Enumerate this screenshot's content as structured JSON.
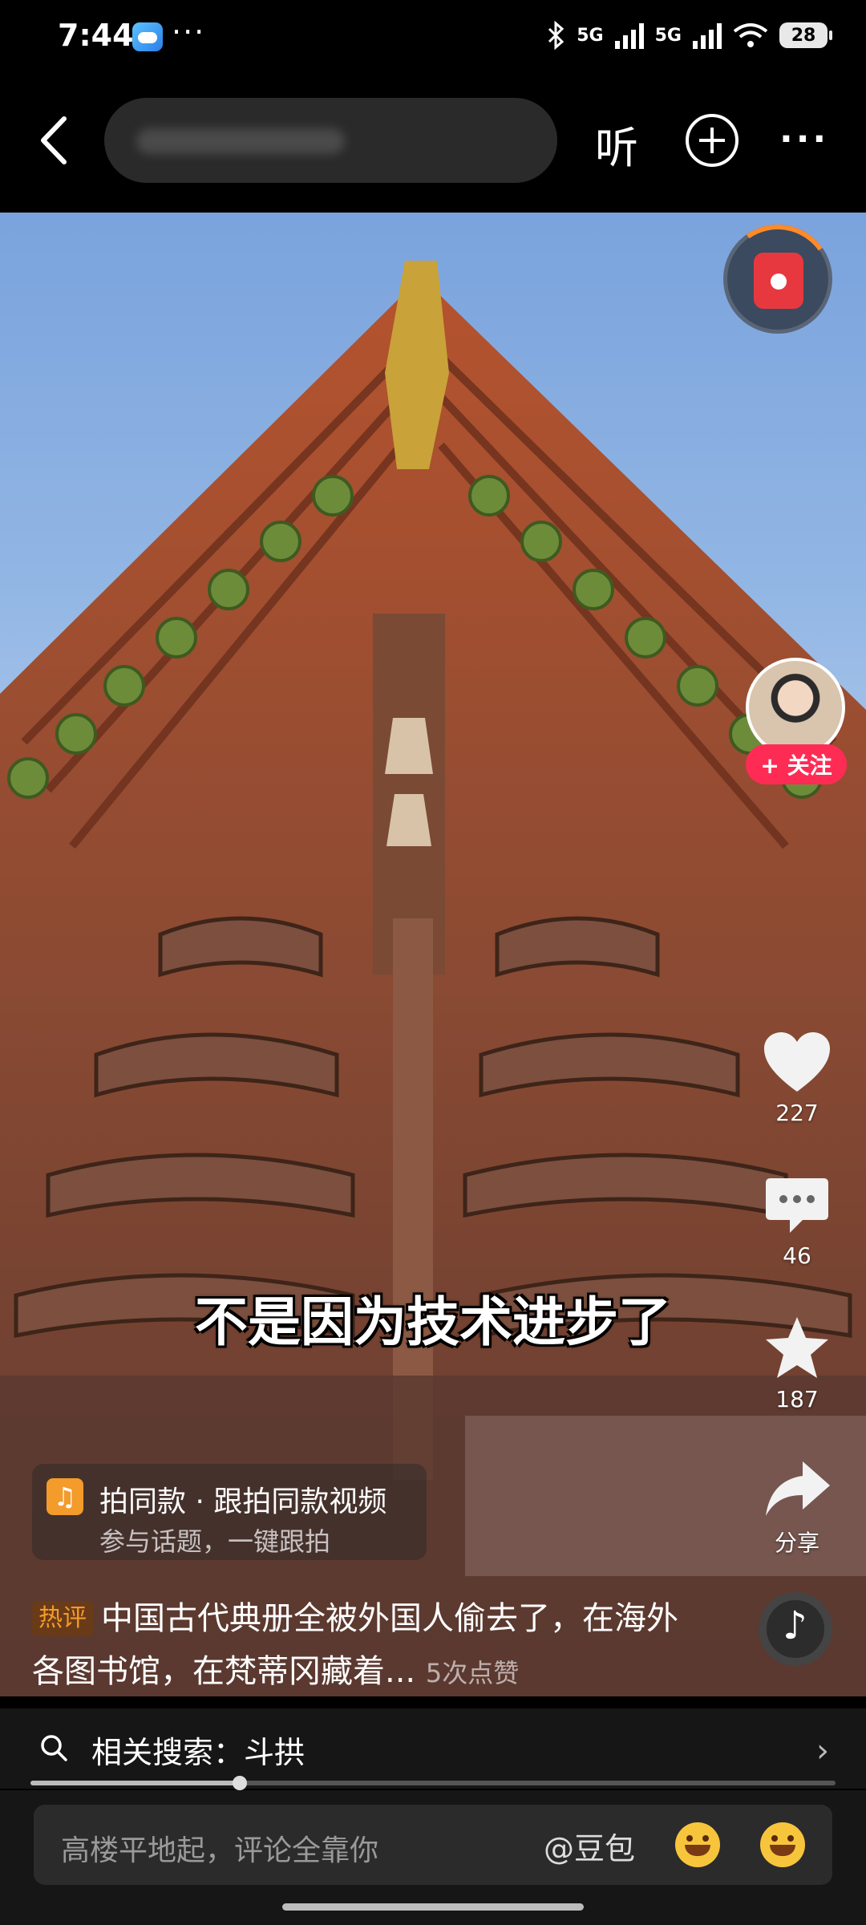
{
  "status_bar": {
    "time": "7:44",
    "dots": "···",
    "network1": "5G",
    "network2": "5G",
    "battery": "28"
  },
  "top_bar": {
    "listen_label": "听"
  },
  "video": {
    "subtitle": "不是因为技术进步了"
  },
  "actions": {
    "follow_label": "+ 关注",
    "likes": "227",
    "comments": "46",
    "favorites": "187",
    "share_label": "分享"
  },
  "same_style": {
    "title": "拍同款 · 跟拍同款视频",
    "subtitle": "参与话题，一键跟拍"
  },
  "hot_comment": {
    "tag": "热评",
    "text": "中国古代典册全被外国人偷去了，在海外各图书馆，在梵蒂冈藏着...",
    "likes": "5次点赞"
  },
  "related_search": {
    "label": "相关搜索：斗拱"
  },
  "playback": {
    "progress": 0.26
  },
  "comment_bar": {
    "placeholder": "高楼平地起，评论全靠你",
    "mention": "@豆包"
  },
  "colors": {
    "accent_red": "#fe2c55",
    "hot_orange": "#f39b2b"
  },
  "icons": [
    "back-icon",
    "plus-icon",
    "more-icon",
    "red-packet-icon",
    "heart-icon",
    "comment-icon",
    "star-icon",
    "share-icon",
    "music-note-icon",
    "search-icon",
    "chevron-right-icon"
  ]
}
